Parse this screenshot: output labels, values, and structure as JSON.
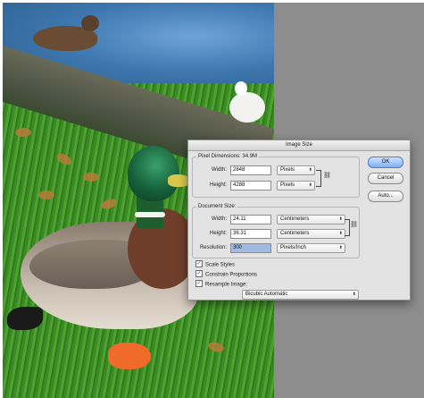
{
  "dialog": {
    "title": "Image Size",
    "pixel_dimensions": {
      "label": "Pixel Dimensions:",
      "size": "34.9M",
      "width_label": "Width:",
      "width_value": "2848",
      "width_unit": "Pixels",
      "height_label": "Height:",
      "height_value": "4288",
      "height_unit": "Pixels"
    },
    "document_size": {
      "label": "Document Size:",
      "width_label": "Width:",
      "width_value": "24.11",
      "width_unit": "Centimeters",
      "height_label": "Height:",
      "height_value": "36.31",
      "height_unit": "Centimeters",
      "resolution_label": "Resolution:",
      "resolution_value": "300",
      "resolution_unit": "Pixels/Inch"
    },
    "checkboxes": {
      "scale_styles": {
        "label": "Scale Styles",
        "checked": true
      },
      "constrain_proportions": {
        "label": "Constrain Proportions",
        "checked": true
      },
      "resample_image": {
        "label": "Resample Image:",
        "checked": true
      }
    },
    "resample_method": "Bicubic Automatic",
    "buttons": {
      "ok": "OK",
      "cancel": "Cancel",
      "auto": "Auto..."
    },
    "check_mark": "✓",
    "arrow_glyph": "⬍",
    "chain_glyph": "⛓"
  },
  "colors": {
    "dialog_bg": "#e3e3e3",
    "default_button": "#7fb0ee",
    "selected_field": "#9fbbe6",
    "canvas_gray": "#8d8d8d"
  }
}
